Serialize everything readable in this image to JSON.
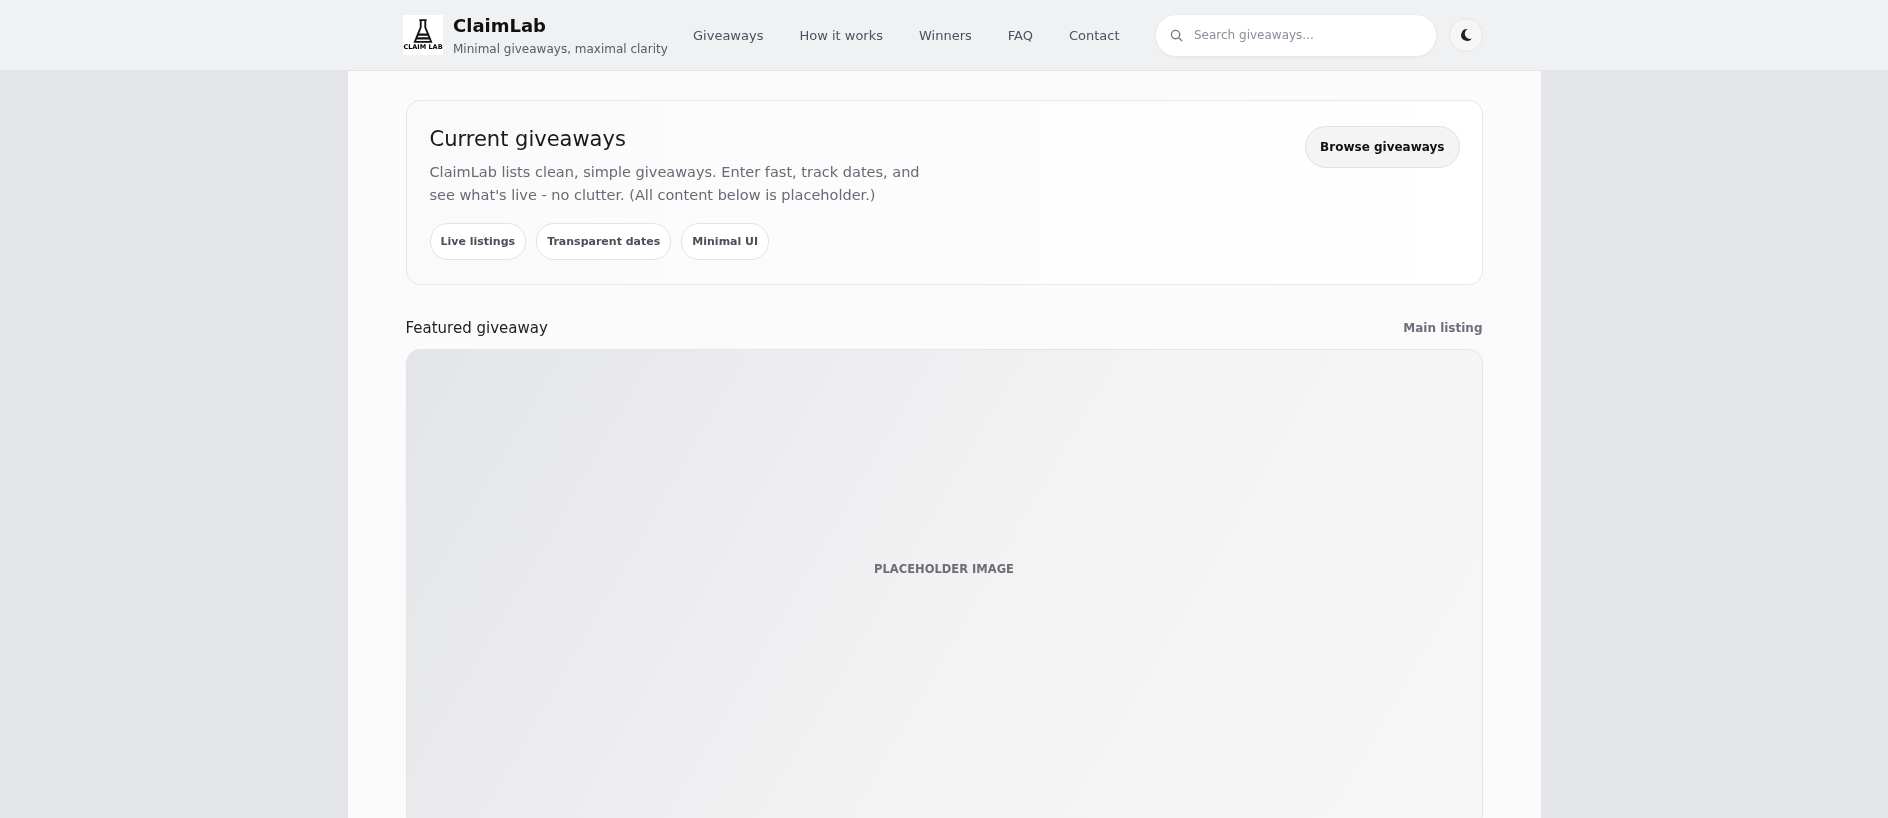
{
  "header": {
    "logo_text": "CLAIM LAB",
    "brand": "ClaimLab",
    "tagline": "Minimal giveaways, maximal clarity",
    "nav": [
      {
        "label": "Giveaways"
      },
      {
        "label": "How it works"
      },
      {
        "label": "Winners"
      },
      {
        "label": "FAQ"
      },
      {
        "label": "Contact"
      }
    ],
    "search": {
      "placeholder": "Search giveaways..."
    }
  },
  "hero": {
    "title": "Current giveaways",
    "text": "ClaimLab lists clean, simple giveaways. Enter fast, track dates, and see what's live - no clutter. (All content below is placeholder.)",
    "button": "Browse giveaways",
    "chips": [
      "Live listings",
      "Transparent dates",
      "Minimal UI"
    ]
  },
  "featured": {
    "title": "Featured giveaway",
    "aside": "Main listing",
    "image_label": "PLACEHOLDER IMAGE"
  }
}
